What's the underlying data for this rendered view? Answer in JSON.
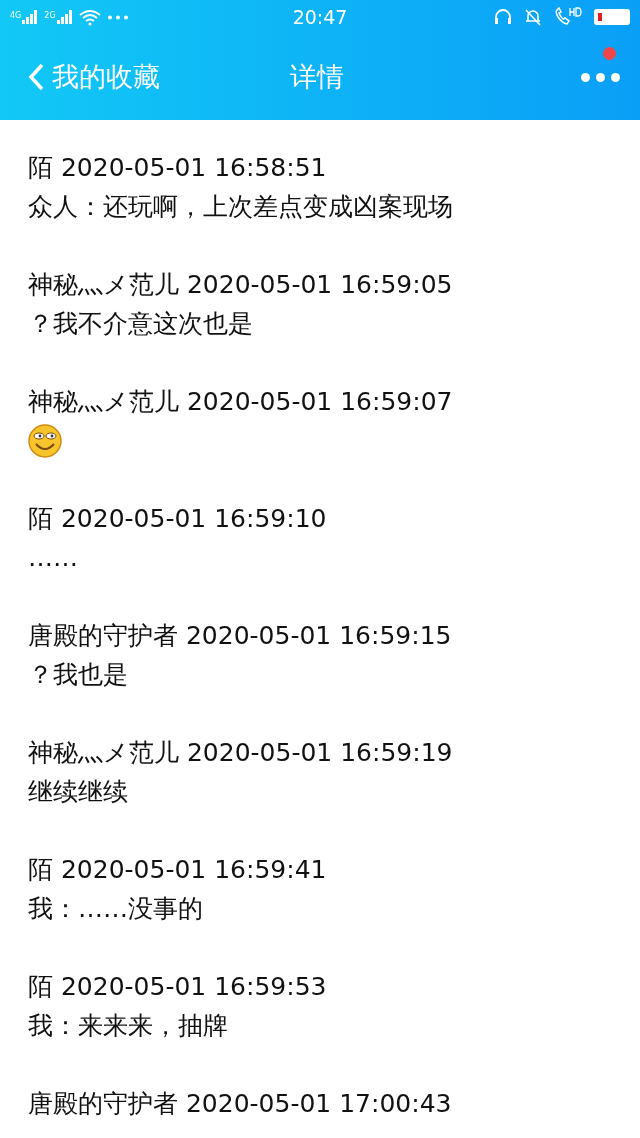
{
  "status_bar": {
    "network_labels": [
      "4G",
      "2G"
    ],
    "time": "20:47"
  },
  "header": {
    "back_label": "我的收藏",
    "title": "详情"
  },
  "messages": [
    {
      "header": "陌 2020-05-01 16:58:51",
      "kind": "text",
      "body": "众人：还玩啊，上次差点变成凶案现场"
    },
    {
      "header": "神秘灬メ范儿 2020-05-01 16:59:05",
      "kind": "text",
      "body": "？我不介意这次也是"
    },
    {
      "header": "神秘灬メ范儿 2020-05-01 16:59:07",
      "kind": "emoji"
    },
    {
      "header": "陌 2020-05-01 16:59:10",
      "kind": "text",
      "body": "……"
    },
    {
      "header": "唐殿的守护者 2020-05-01 16:59:15",
      "kind": "text",
      "body": "？我也是"
    },
    {
      "header": "神秘灬メ范儿 2020-05-01 16:59:19",
      "kind": "text",
      "body": "继续继续"
    },
    {
      "header": "陌 2020-05-01 16:59:41",
      "kind": "text",
      "body": "我：……没事的"
    },
    {
      "header": "陌 2020-05-01 16:59:53",
      "kind": "text",
      "body": "我：来来来，抽牌"
    },
    {
      "header": "唐殿的守护者 2020-05-01 17:00:43",
      "kind": "cut"
    }
  ]
}
